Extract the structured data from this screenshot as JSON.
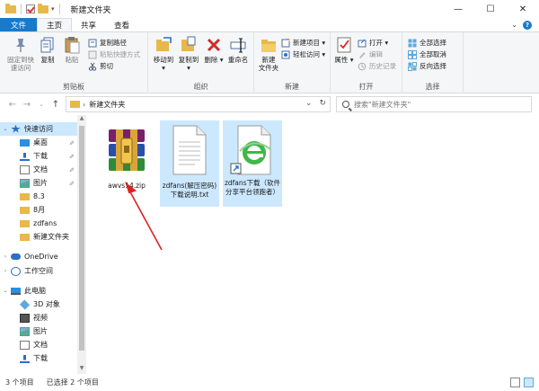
{
  "window": {
    "title": "新建文件夹",
    "controls": [
      "—",
      "☐",
      "✕"
    ]
  },
  "tabs": [
    "文件",
    "主页",
    "共享",
    "查看"
  ],
  "ribbon": {
    "clipboard": {
      "pin": "固定到快\n速访问",
      "copy": "复制",
      "paste": "粘贴",
      "copy_path": "复制路径",
      "paste_shortcut": "粘贴快捷方式",
      "cut": "剪切",
      "label": "剪贴板"
    },
    "organize": {
      "move_to": "移动到",
      "copy_to": "复制到",
      "delete": "删除",
      "rename": "重命名",
      "label": "组织"
    },
    "new": {
      "new_folder": "新建\n文件夹",
      "new_item": "新建项目",
      "easy_access": "轻松访问",
      "label": "新建"
    },
    "open": {
      "properties": "属性",
      "open": "打开",
      "edit": "编辑",
      "history": "历史记录",
      "label": "打开"
    },
    "select": {
      "select_all": "全部选择",
      "select_none": "全部取消",
      "invert": "反向选择",
      "label": "选择"
    }
  },
  "address": {
    "path": "新建文件夹",
    "search_placeholder": "搜索\"新建文件夹\""
  },
  "nav": {
    "items": [
      {
        "label": "快速访问",
        "icon": "star-icon"
      },
      {
        "label": "桌面",
        "icon": "desktop-icon"
      },
      {
        "label": "下载",
        "icon": "download-icon"
      },
      {
        "label": "文档",
        "icon": "document-icon"
      },
      {
        "label": "图片",
        "icon": "picture-icon"
      },
      {
        "label": "8.3",
        "icon": "folder-icon"
      },
      {
        "label": "8月",
        "icon": "folder-icon"
      },
      {
        "label": "zdfans",
        "icon": "folder-icon"
      },
      {
        "label": "新建文件夹",
        "icon": "folder-icon"
      },
      {
        "label": "OneDrive",
        "icon": "cloud-icon"
      },
      {
        "label": "工作空间",
        "icon": "workspace-icon"
      },
      {
        "label": "此电脑",
        "icon": "computer-icon"
      },
      {
        "label": "3D 对象",
        "icon": "cube-icon"
      },
      {
        "label": "视频",
        "icon": "video-icon"
      },
      {
        "label": "图片",
        "icon": "picture-icon"
      },
      {
        "label": "文档",
        "icon": "document-icon"
      },
      {
        "label": "下载",
        "icon": "download-icon"
      }
    ]
  },
  "files": [
    {
      "name": "awvs14.zip",
      "icon": "winrar-archive-icon",
      "selected": false
    },
    {
      "name": "zdfans(解压密码)下载说明.txt",
      "icon": "text-file-icon",
      "selected": true
    },
    {
      "name": "zdfans下载（软件分享平台领跑者）",
      "icon": "ie-shortcut-icon",
      "selected": true
    }
  ],
  "status": {
    "count": "3 个项目",
    "selected": "已选择 2 个项目"
  },
  "colors": {
    "accent": "#1979ca",
    "selection": "#cce8ff",
    "annotation": "#e02020"
  }
}
